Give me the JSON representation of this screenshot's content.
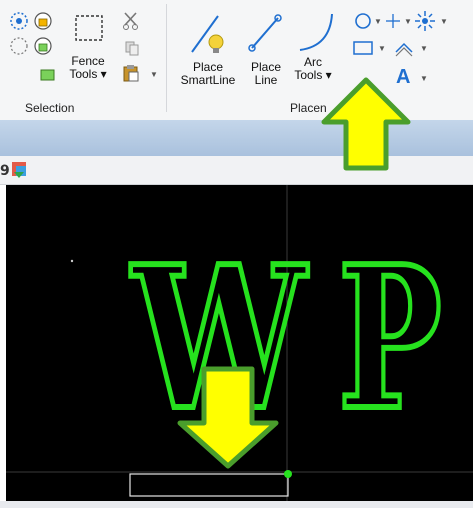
{
  "ribbon": {
    "selection_group": {
      "label": "Selection",
      "fence_tools_label": "Fence\nTools ▾"
    },
    "placement_group": {
      "label": "Placement",
      "visible_label_fragment": "Placen",
      "place_smartline_label": "Place\nSmartLine",
      "place_line_label": "Place\nLine",
      "arc_tools_label": "Arc\nTools ▾",
      "text_tool_glyph": "A"
    }
  },
  "canvas": {
    "letters": [
      "W",
      "P"
    ],
    "text_color": "#26e21e",
    "background": "#000000"
  },
  "annotations": {
    "arrow_color": "#ffff00",
    "arrow_outline": "#4a9e2c"
  },
  "colors": {
    "ribbon_icon_blue": "#1f6fd0",
    "accent_gold": "#f4b400"
  }
}
